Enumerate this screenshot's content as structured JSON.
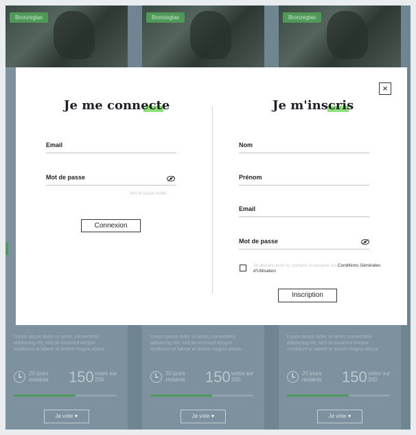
{
  "background": {
    "cards": [
      {
        "tag": "Bronzeglas",
        "desc": "Lorem ipsum dolor sit amet, consectetur adipiscing elit, sed do eiusmod tempor incididunt ut labore et dolore magna aliqua.",
        "days": "20 jours restants",
        "votes": "150",
        "votes_label": "votes sur 200",
        "progress": 0.6,
        "vote_button": "Je vote ♥"
      },
      {
        "tag": "Bronzeglas",
        "desc": "Lorem ipsum dolor sit amet, consectetur adipiscing elit, sed do eiusmod tempor incididunt ut labore et dolore magna aliqua.",
        "days": "20 jours restants",
        "votes": "150",
        "votes_label": "votes sur 200",
        "progress": 0.6,
        "vote_button": "Je vote ♥"
      },
      {
        "tag": "Bronzeglas",
        "desc": "Lorem ipsum dolor sit amet, consectetur adipiscing elit, sed do eiusmod tempor incididunt ut labore et dolore magna aliqua.",
        "days": "20 jours restants",
        "votes": "150",
        "votes_label": "votes sur 200",
        "progress": 0.6,
        "vote_button": "Je vote ♥"
      }
    ]
  },
  "modal": {
    "close_label": "×",
    "login": {
      "title": "Je me connecte",
      "email_label": "Email",
      "password_label": "Mot de passe",
      "forgot_label": "Mot de passe oublié",
      "submit_label": "Connexion"
    },
    "signup": {
      "title": "Je m'inscris",
      "nom_label": "Nom",
      "prenom_label": "Prénom",
      "email_label": "Email",
      "password_label": "Mot de passe",
      "terms_prefix": "Je déclare avoir lu, compris et accepté les",
      "terms_link": "Conditions Générales d'Utilisation",
      "submit_label": "Inscription"
    },
    "accent_color": "#8fe07e"
  }
}
